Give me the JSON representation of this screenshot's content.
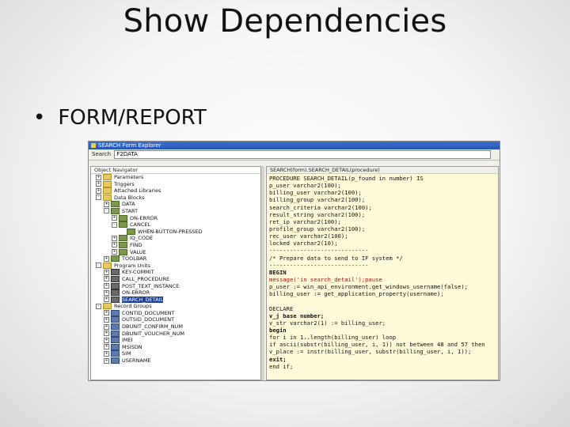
{
  "slide": {
    "title": "Show Dependencies",
    "bullet": "FORM/REPORT"
  },
  "window": {
    "title": "SEARCH Form Explorer",
    "search_label": "Search",
    "search_value": "F2DATA"
  },
  "navigator": {
    "header": "Object Navigator",
    "items": [
      {
        "label": "Parameters",
        "icon": "folder-icon",
        "indent": 0,
        "exp": "+"
      },
      {
        "label": "Triggers",
        "icon": "folder-icon",
        "indent": 0,
        "exp": "+"
      },
      {
        "label": "Attached Libraries",
        "icon": "folder-icon",
        "indent": 0,
        "exp": "+"
      },
      {
        "label": "Data Blocks",
        "icon": "folder-icon",
        "indent": 0,
        "exp": "-"
      },
      {
        "label": "DATA",
        "icon": "block-icon",
        "indent": 1,
        "exp": "+"
      },
      {
        "label": "START",
        "icon": "block-icon",
        "indent": 1,
        "exp": "-"
      },
      {
        "label": "ON-ERROR",
        "icon": "block-icon",
        "indent": 2,
        "exp": "+"
      },
      {
        "label": "CANCEL",
        "icon": "block-icon",
        "indent": 2,
        "exp": "-"
      },
      {
        "label": "WHEN-BUTTON-PRESSED",
        "icon": "trigger-icon",
        "indent": 3,
        "exp": ""
      },
      {
        "label": "IQ_CODE",
        "icon": "block-icon",
        "indent": 2,
        "exp": "+"
      },
      {
        "label": "FIND",
        "icon": "block-icon",
        "indent": 2,
        "exp": "+"
      },
      {
        "label": "VALUE",
        "icon": "block-icon",
        "indent": 2,
        "exp": "+"
      },
      {
        "label": "TOOLBAR",
        "icon": "block-icon",
        "indent": 1,
        "exp": "+"
      },
      {
        "label": "Program Units",
        "icon": "folder-icon",
        "indent": 0,
        "exp": "-"
      },
      {
        "label": "KEY-COMMIT",
        "icon": "procedure-icon",
        "indent": 1,
        "exp": "+"
      },
      {
        "label": "CALL_PROCEDURE",
        "icon": "procedure-icon",
        "indent": 1,
        "exp": "+"
      },
      {
        "label": "POST_TEXT_INSTANCE",
        "icon": "procedure-icon",
        "indent": 1,
        "exp": "+"
      },
      {
        "label": "ON-ERROR",
        "icon": "procedure-icon",
        "indent": 1,
        "exp": "+"
      },
      {
        "label": "SEARCH_DETAIL",
        "icon": "procedure-icon",
        "indent": 1,
        "exp": "+",
        "selected": true
      },
      {
        "label": "Record Groups",
        "icon": "folder-icon",
        "indent": 0,
        "exp": "-"
      },
      {
        "label": "CONTID_DOCUMENT",
        "icon": "record-icon",
        "indent": 1,
        "exp": "+"
      },
      {
        "label": "OUTSID_DOCUMENT",
        "icon": "record-icon",
        "indent": 1,
        "exp": "+"
      },
      {
        "label": "DBUNIT_CONFIRM_NUM",
        "icon": "record-icon",
        "indent": 1,
        "exp": "+"
      },
      {
        "label": "DBUNIT_VOUCHER_NUM",
        "icon": "record-icon",
        "indent": 1,
        "exp": "+"
      },
      {
        "label": "IMEI",
        "icon": "record-icon",
        "indent": 1,
        "exp": "+"
      },
      {
        "label": "MSISDN",
        "icon": "record-icon",
        "indent": 1,
        "exp": "+"
      },
      {
        "label": "SIM",
        "icon": "record-icon",
        "indent": 1,
        "exp": "+"
      },
      {
        "label": "USERNAME",
        "icon": "record-icon",
        "indent": 1,
        "exp": "+"
      }
    ]
  },
  "code_view": {
    "header": "SEARCH(form).SEARCH_DETAIL(procedure)",
    "lines": [
      {
        "text": "PROCEDURE SEARCH_DETAIL(p_found in number) IS",
        "color": "#111111",
        "bold": false
      },
      {
        "text": "  p_user varchar2(100);",
        "color": "#111111",
        "bold": false
      },
      {
        "text": "  billing_user varchar2(100);",
        "color": "#111111",
        "bold": false
      },
      {
        "text": "  billing_group varchar2(100);",
        "color": "#111111",
        "bold": false
      },
      {
        "text": "  search_criteria varchar2(100);",
        "color": "#111111",
        "bold": false
      },
      {
        "text": "  result_string varchar2(100);",
        "color": "#111111",
        "bold": false
      },
      {
        "text": "  ret_ip varchar2(100);",
        "color": "#111111",
        "bold": false
      },
      {
        "text": "  profile_group varchar2(100);",
        "color": "#111111",
        "bold": false
      },
      {
        "text": "  rec_user varchar2(100);",
        "color": "#111111",
        "bold": false
      },
      {
        "text": "  locked varchar2(10);",
        "color": "#111111",
        "bold": false
      },
      {
        "text": "-----------------------------",
        "color": "#111111",
        "bold": false
      },
      {
        "text": "/* Prepare data to send to IF system */",
        "color": "#111111",
        "bold": false
      },
      {
        "text": "-----------------------------",
        "color": "#111111",
        "bold": false
      },
      {
        "text": "BEGIN",
        "color": "#111111",
        "bold": true
      },
      {
        "text": "  message('in search_detail');pause",
        "color": "#b01010",
        "bold": false
      },
      {
        "text": "  p_user := win_api_environment.get_windows_username(false);",
        "color": "#111111",
        "bold": false
      },
      {
        "text": "  billing_user := get_application_property(username);",
        "color": "#111111",
        "bold": false
      },
      {
        "text": "",
        "color": "#111111",
        "bold": false
      },
      {
        "text": "DECLARE",
        "color": "#111111",
        "bold": false
      },
      {
        "text": "v_j base number;",
        "color": "#111111",
        "bold": true
      },
      {
        "text": "v_str varchar2(1) := billing_user;",
        "color": "#111111",
        "bold": false
      },
      {
        "text": "begin",
        "color": "#111111",
        "bold": true
      },
      {
        "text": "for i in 1..length(billing_user) loop",
        "color": "#111111",
        "bold": false
      },
      {
        "text": "  if ascii(substr(billing_user, i, 1)) not between 48 and 57 then",
        "color": "#111111",
        "bold": false
      },
      {
        "text": "    v_place := instr(billing_user, substr(billing_user, i, 1));",
        "color": "#111111",
        "bold": false
      },
      {
        "text": "    exit;",
        "color": "#111111",
        "bold": true
      },
      {
        "text": "end if;",
        "color": "#111111",
        "bold": false
      }
    ]
  },
  "colors": {
    "titlebar": "#2456b8",
    "code_background": "#fffbd8",
    "selection": "#1a3fa0",
    "string_text": "#b01010"
  }
}
